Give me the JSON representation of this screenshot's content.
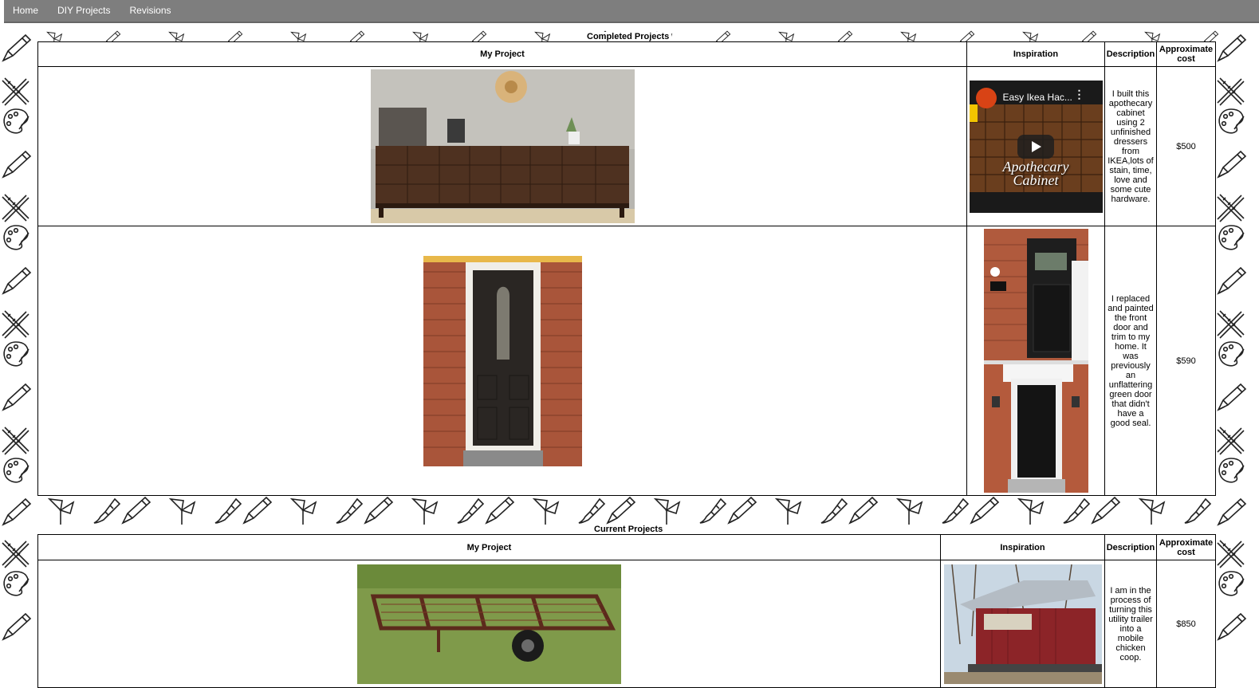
{
  "nav": {
    "items": [
      {
        "label": "Home"
      },
      {
        "label": "DIY Projects"
      },
      {
        "label": "Revisions"
      }
    ]
  },
  "completed": {
    "caption": "Completed Projects",
    "headers": {
      "project": "My Project",
      "inspiration": "Inspiration",
      "description": "Description",
      "cost": "Approximate cost"
    },
    "rows": [
      {
        "project_image": "apothecary cabinet photo",
        "inspiration_video_title": "Easy Ikea Hac...",
        "inspiration_caption_line1": "Apothecary",
        "inspiration_caption_line2": "Cabinet",
        "description": "I built this apothecary cabinet using 2 unfinished dressers from IKEA,lots of stain, time, love and some cute hardware.",
        "cost": "$500"
      },
      {
        "project_image": "black front door photo",
        "inspiration_image": "black door inspiration photos",
        "description": "I replaced and painted the front door and trim to my home. It was previously an unflattering green door that didn't have a good seal.",
        "cost": "$590"
      }
    ]
  },
  "current": {
    "caption": "Current Projects",
    "headers": {
      "project": "My Project",
      "inspiration": "Inspiration",
      "description": "Description",
      "cost": "Approximate cost"
    },
    "rows": [
      {
        "project_image": "utility trailer photo",
        "inspiration_image": "mobile chicken coop photo",
        "description": "I am in the process of turning this utility trailer into a mobile chicken coop.",
        "cost": "$850"
      }
    ]
  },
  "colors": {
    "nav_bg": "#7e7e7e",
    "nav_text": "#ffffff",
    "border": "#000000"
  }
}
